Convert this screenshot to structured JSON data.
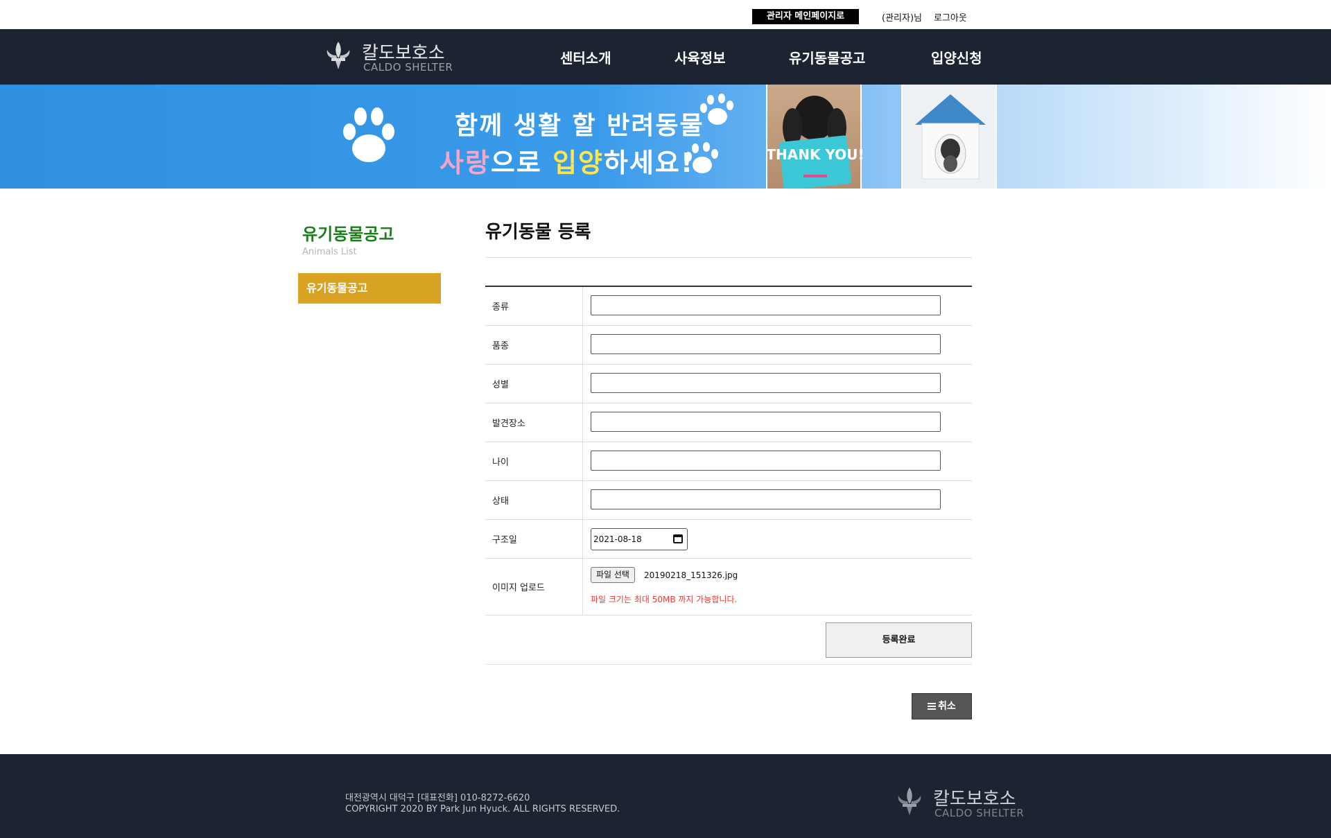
{
  "top_bar": {
    "admin_main_link": "관리자 메인페이지로",
    "user_label": "(관리자)님",
    "logout": "로그아웃"
  },
  "header": {
    "logo_korean": "칼도보호소",
    "logo_english": "CALDO SHELTER",
    "nav": [
      "센터소개",
      "사육정보",
      "유기동물공고",
      "입양신청"
    ]
  },
  "banner": {
    "line1": "함께 생활 할 반려동물",
    "line2_parts": [
      "사랑",
      "으로 ",
      "입양",
      "하세요!"
    ],
    "photo_text": "THANK YOU!"
  },
  "sidebar": {
    "title": "유기동물공고",
    "subtitle": "Animals List",
    "menu_item": "유기동물공고"
  },
  "main": {
    "title": "유기동물 등록",
    "labels": [
      "종류",
      "품종",
      "성별",
      "발견장소",
      "나이",
      "상태",
      "구조일",
      "이미지 업로드"
    ],
    "rescue_date": "2021-08-18",
    "file_button": "파일 선택",
    "file_name": "20190218_151326.jpg",
    "file_note": "파일 크기는 최대 50MB 까지 가능합니다.",
    "submit": "등록완료",
    "cancel": "취소"
  },
  "footer": {
    "address": "대전광역시 대덕구 [대표전화] 010-8272-6620",
    "copyright": "COPYRIGHT 2020 BY Park Jun Hyuck. ALL RIGHTS RESERVED."
  },
  "colors": {
    "header_bg": "#1b2430",
    "sidebar_active": "#d8a323",
    "sidebar_title": "#1a7f1a",
    "note_red": "#e53935",
    "banner_blue": "#2f8fe0"
  }
}
